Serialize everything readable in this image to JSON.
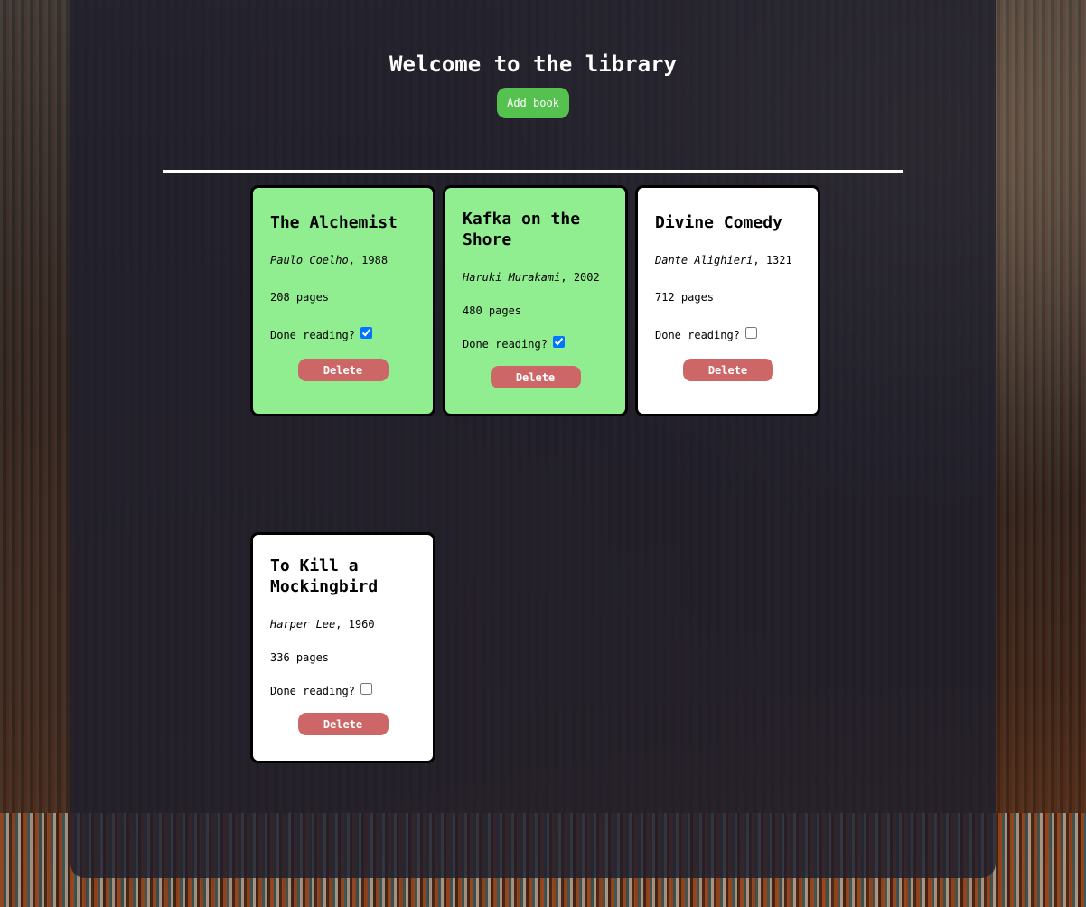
{
  "header": {
    "title": "Welcome to the library",
    "add_button_label": "Add book"
  },
  "books": [
    {
      "title": "The Alchemist",
      "author": "Paulo Coelho",
      "year": ", 1988",
      "pages": "208 pages",
      "done_label": "Done reading?",
      "done": true,
      "delete_label": "Delete"
    },
    {
      "title": "Kafka on the Shore",
      "author": "Haruki Murakami",
      "year": ", 2002",
      "pages": "480 pages",
      "done_label": "Done reading?",
      "done": true,
      "delete_label": "Delete"
    },
    {
      "title": "Divine Comedy",
      "author": "Dante Alighieri",
      "year": ", 1321",
      "pages": "712 pages",
      "done_label": "Done reading?",
      "done": false,
      "delete_label": "Delete"
    },
    {
      "title": "To Kill a Mockingbird",
      "author": "Harper Lee",
      "year": ", 1960",
      "pages": "336 pages",
      "done_label": "Done reading?",
      "done": false,
      "delete_label": "Delete"
    }
  ],
  "colors": {
    "read_card": "#90ee90",
    "unread_card": "#ffffff",
    "add_button": "#55c24f",
    "delete_button": "#cd6767"
  }
}
